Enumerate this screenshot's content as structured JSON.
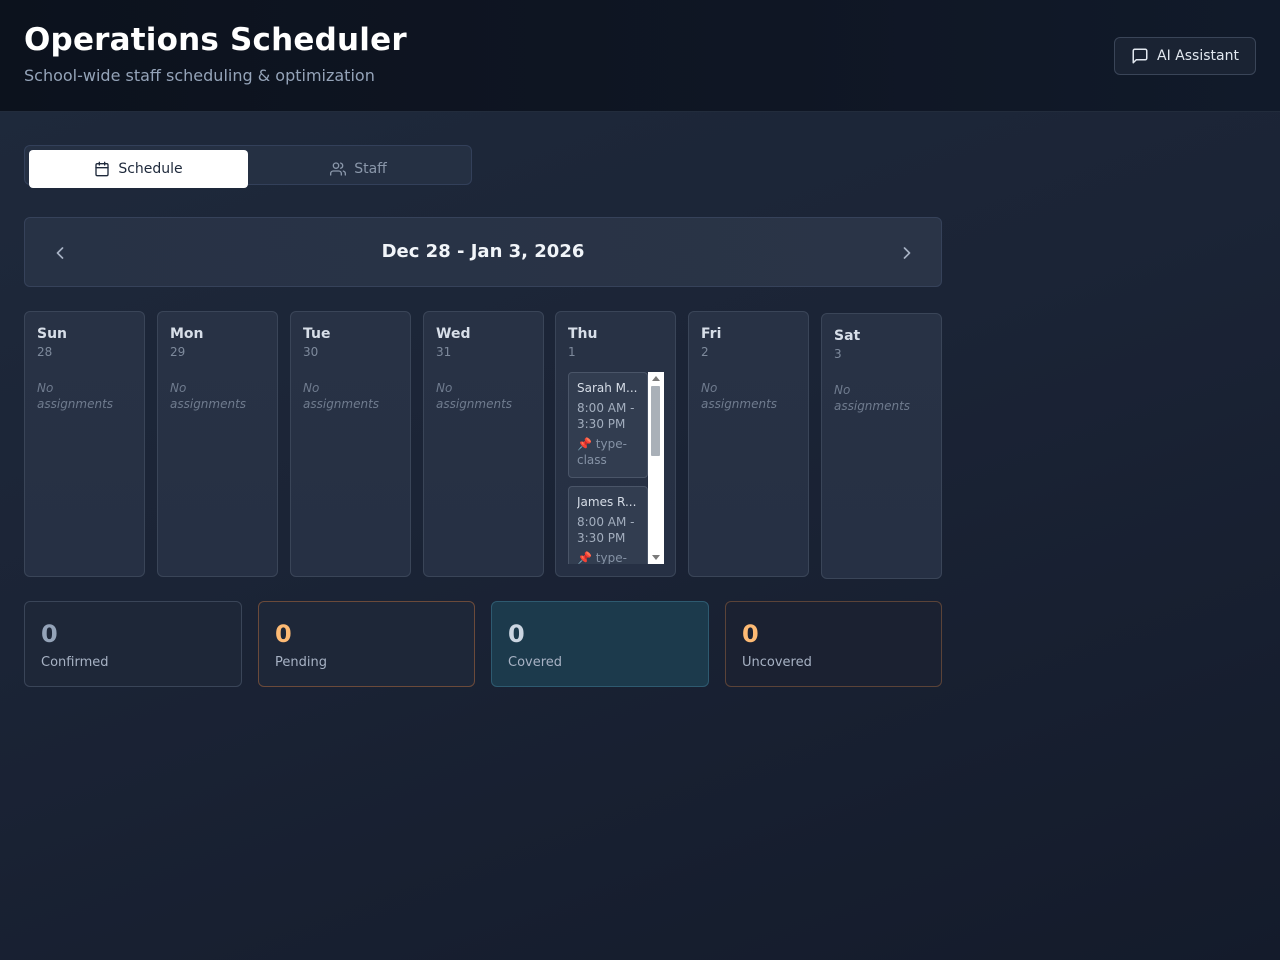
{
  "header": {
    "title": "Operations Scheduler",
    "subtitle": "School-wide staff scheduling & optimization",
    "ai_button_label": "AI Assistant"
  },
  "tabs": [
    {
      "label": "Schedule",
      "icon": "calendar-icon",
      "active": true
    },
    {
      "label": "Staff",
      "icon": "users-icon",
      "active": false
    }
  ],
  "week": {
    "range": "Dec 28 - Jan 3, 2026"
  },
  "days": [
    {
      "name": "Sun",
      "date": "28",
      "empty_text": "No assignments"
    },
    {
      "name": "Mon",
      "date": "29",
      "empty_text": "No assignments"
    },
    {
      "name": "Tue",
      "date": "30",
      "empty_text": "No assignments"
    },
    {
      "name": "Wed",
      "date": "31",
      "empty_text": "No assignments"
    },
    {
      "name": "Thu",
      "date": "1",
      "assignments": [
        {
          "who": "Sarah M...",
          "time": "8:00 AM - 3:30 PM",
          "type": "type-class"
        },
        {
          "who": "James R...",
          "time": "8:00 AM - 3:30 PM",
          "type": "type-class"
        }
      ]
    },
    {
      "name": "Fri",
      "date": "2",
      "empty_text": "No assignments"
    },
    {
      "name": "Sat",
      "date": "3",
      "empty_text": "No assignments"
    }
  ],
  "stats": [
    {
      "value": "0",
      "label": "Confirmed",
      "color": "#94a3b8"
    },
    {
      "value": "0",
      "label": "Pending",
      "color": "#fdba74"
    },
    {
      "value": "0",
      "label": "Covered",
      "color": "#cbd5e1"
    },
    {
      "value": "0",
      "label": "Uncovered",
      "color": "#fdba74"
    }
  ]
}
